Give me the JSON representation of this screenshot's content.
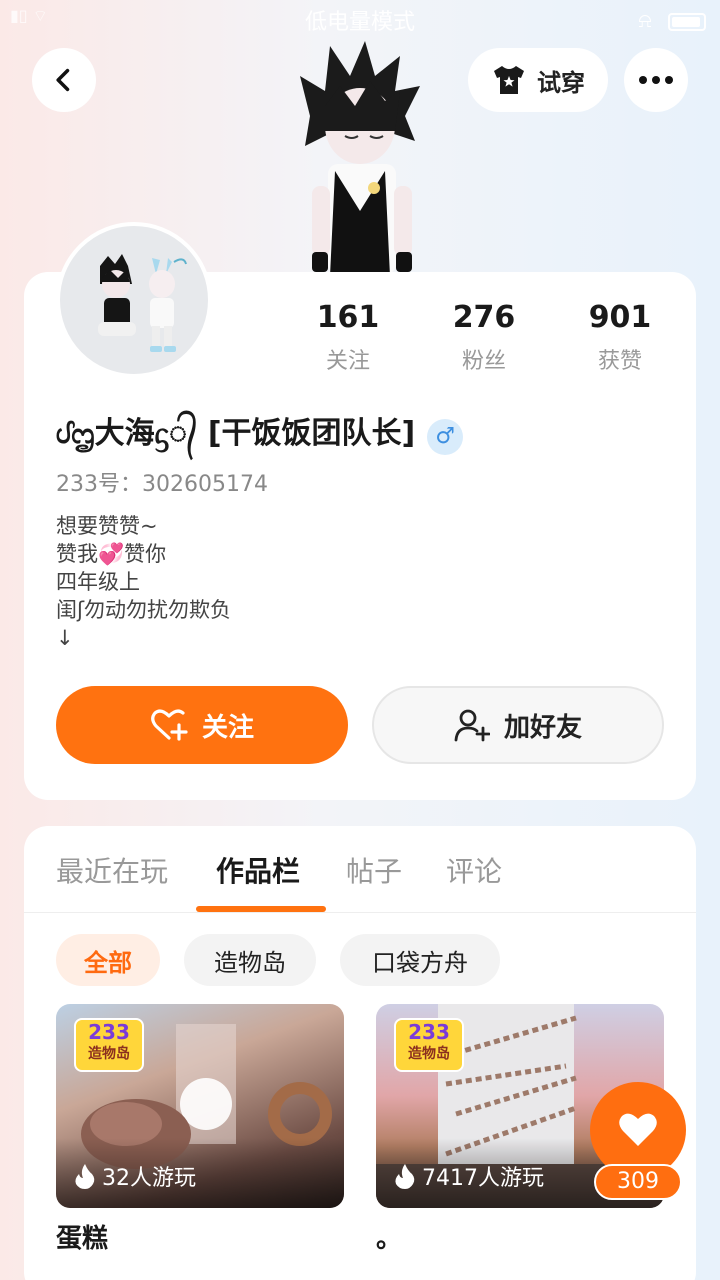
{
  "status_bar": {
    "mode_text": "低电量模式"
  },
  "header": {
    "tryon_label": "试穿"
  },
  "profile": {
    "stats": [
      {
        "value": "161",
        "label": "关注"
      },
      {
        "value": "276",
        "label": "粉丝"
      },
      {
        "value": "901",
        "label": "获赞"
      }
    ],
    "nickname": "ᦔᦗ大海ᦓ᭄ [干饭饭团队长]",
    "gender_symbol": "♂",
    "uid": "233号：302605174",
    "bio_lines": [
      "想要赞赞~",
      "赞我💞赞你",
      "四年级上",
      "闺ʃ勿动勿扰勿欺负",
      "↓"
    ]
  },
  "actions": {
    "follow_label": "关注",
    "add_friend_label": "加好友"
  },
  "tabs": [
    "最近在玩",
    "作品栏",
    "帖子",
    "评论"
  ],
  "active_tab": "作品栏",
  "filters": [
    "全部",
    "造物岛",
    "口袋方舟"
  ],
  "works": [
    {
      "badge_top": "233",
      "badge_bottom": "造物岛",
      "plays": "32人游玩",
      "title": "蛋糕"
    },
    {
      "badge_top": "233",
      "badge_bottom": "造物岛",
      "plays": "7417人游玩",
      "title": "。"
    }
  ],
  "like_fab": {
    "count": "309"
  },
  "colors": {
    "accent": "#ff7210",
    "gender": "#3d8fe0"
  }
}
